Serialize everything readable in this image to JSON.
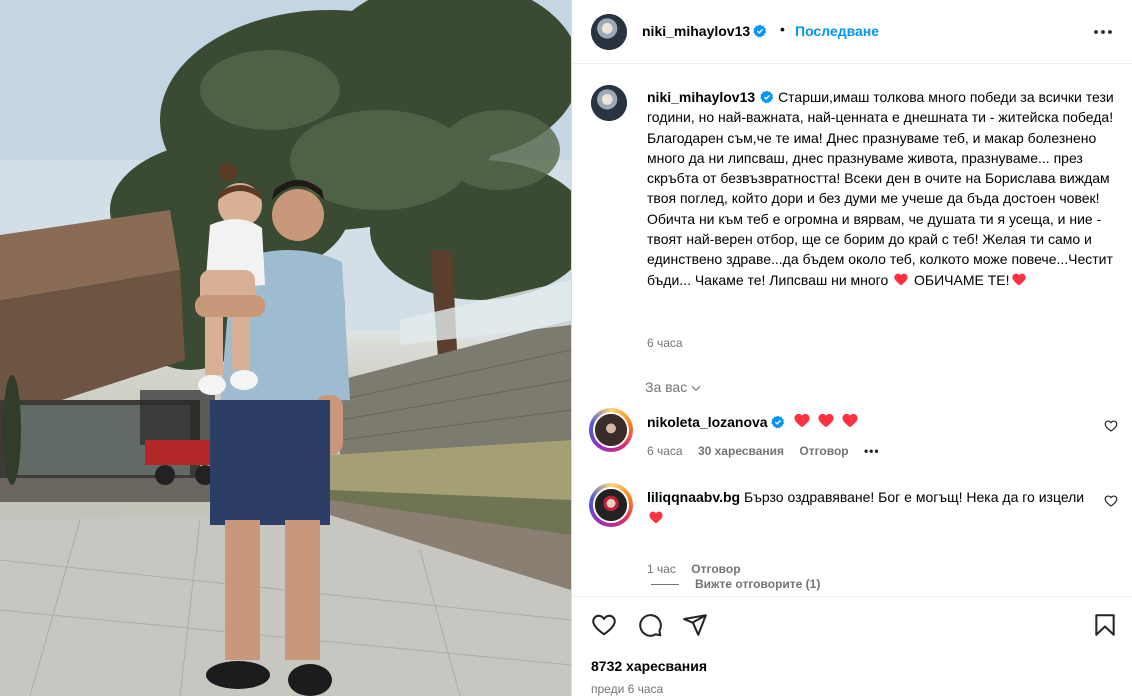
{
  "post": {
    "author": "niki_mihaylov13",
    "follow_label": "Последване",
    "separator": "•",
    "caption": "Старши,имаш толкова много победи за всички тези години, но най-важната, най-ценната е днешната ти - житейска победа! Благодарен съм,че те има! Днес празнуваме теб, и макар болезнено много да ни липсваш, днес празнуваме живота, празнуваме... през скръбта от безвъзвратността! Всеки ден в очите на Борислава виждам твоя поглед, който дори и без думи ме учеше да бъда достоен човек! Обичта ни към теб е огромна и вярвам, че душата ти я усеща, и ние - твоят най-верен отбор, ще се борим до край с теб! Желая ти само и единствено здраве...да бъдем около теб, колкото може повече...Честит бъди... Чакаме те! Липсваш ни много",
    "caption_end": "ОБИЧАМЕ ТЕ!",
    "caption_time": "6 часа",
    "likes": "8732 харесвания",
    "posted": "преди 6 часа"
  },
  "filter": {
    "label": "За вас"
  },
  "comments": [
    {
      "user": "nikoleta_lozanova",
      "verified": true,
      "time": "6 часа",
      "likes": "30 харесвания",
      "reply": "Отговор",
      "more": "•••"
    },
    {
      "user": "liliqqnaabv.bg",
      "text": "Бързо оздравяване! Бог е могъщ! Нека да го изцели",
      "time": "1 час",
      "reply": "Отговор",
      "view_replies": "Вижте отговорите (1)"
    }
  ],
  "colors": {
    "accent": "#0095f6",
    "heart": "#ff3040",
    "muted": "#737373"
  },
  "icons": [
    "more-icon",
    "verified-icon",
    "heart-icon",
    "comment-icon",
    "share-icon",
    "bookmark-icon",
    "chevron-down-icon"
  ]
}
